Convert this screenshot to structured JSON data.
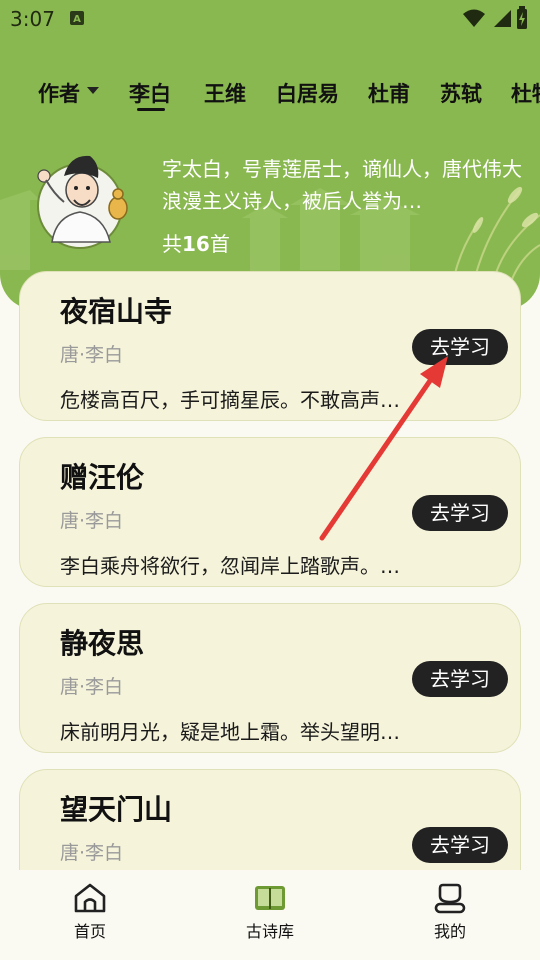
{
  "status_bar": {
    "time": "3:07"
  },
  "author_filter": {
    "label": "作者"
  },
  "author_tabs": [
    {
      "label": "李白",
      "selected": true
    },
    {
      "label": "王维",
      "selected": false
    },
    {
      "label": "白居易",
      "selected": false
    },
    {
      "label": "杜甫",
      "selected": false
    },
    {
      "label": "苏轼",
      "selected": false
    },
    {
      "label": "杜牧",
      "selected": false
    }
  ],
  "author": {
    "bio": "字太白，号青莲居士，谪仙人，唐代伟大浪漫主义诗人，被后人誉为…",
    "count_prefix": "共",
    "count_value": "16",
    "count_suffix": "首"
  },
  "poems": [
    {
      "title": "夜宿山寺",
      "dynasty_author": "唐·李白",
      "excerpt": "危楼高百尺，手可摘星辰。不敢高声…",
      "button": "去学习"
    },
    {
      "title": "赠汪伦",
      "dynasty_author": "唐·李白",
      "excerpt": "李白乘舟将欲行，忽闻岸上踏歌声。…",
      "button": "去学习"
    },
    {
      "title": "静夜思",
      "dynasty_author": "唐·李白",
      "excerpt": "床前明月光，疑是地上霜。举头望明…",
      "button": "去学习"
    },
    {
      "title": "望天门山",
      "dynasty_author": "唐·李白",
      "excerpt": "",
      "button": "去学习"
    }
  ],
  "bottom_nav": [
    {
      "label": "首页",
      "icon": "home-icon"
    },
    {
      "label": "古诗库",
      "icon": "book-icon"
    },
    {
      "label": "我的",
      "icon": "profile-icon"
    }
  ],
  "colors": {
    "header_green": "#8ab850",
    "card_bg": "#f5f3da",
    "button_bg": "#222222",
    "annotation_arrow": "#e53935"
  }
}
